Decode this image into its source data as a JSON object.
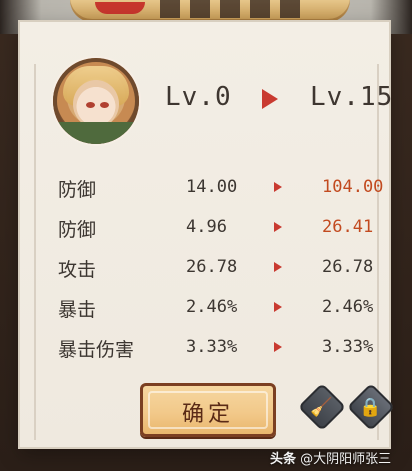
{
  "header": {
    "current_level": "Lv.0",
    "target_level": "Lv.15"
  },
  "stats": [
    {
      "label": "防御",
      "from": "14.00",
      "to": "104.00",
      "to_highlight": true
    },
    {
      "label": "防御",
      "from": "4.96",
      "to": "26.41",
      "to_highlight": true
    },
    {
      "label": "攻击",
      "from": "26.78",
      "to": "26.78",
      "to_highlight": false
    },
    {
      "label": "暴击",
      "from": "2.46%",
      "to": "2.46%",
      "to_highlight": false
    },
    {
      "label": "暴击伤害",
      "from": "3.33%",
      "to": "3.33%",
      "to_highlight": false
    }
  ],
  "actions": {
    "confirm_label": "确定",
    "clean_icon": "broom-icon",
    "lock_icon": "lock-icon"
  },
  "watermark": {
    "logo": "头条",
    "text": "@大阴阳师张三"
  },
  "colors": {
    "paper": "#efe9df",
    "arrow_red": "#c93a30",
    "highlight_value": "#c24a1f",
    "button_gold": "#f2c98a",
    "button_border": "#7b3f22"
  }
}
